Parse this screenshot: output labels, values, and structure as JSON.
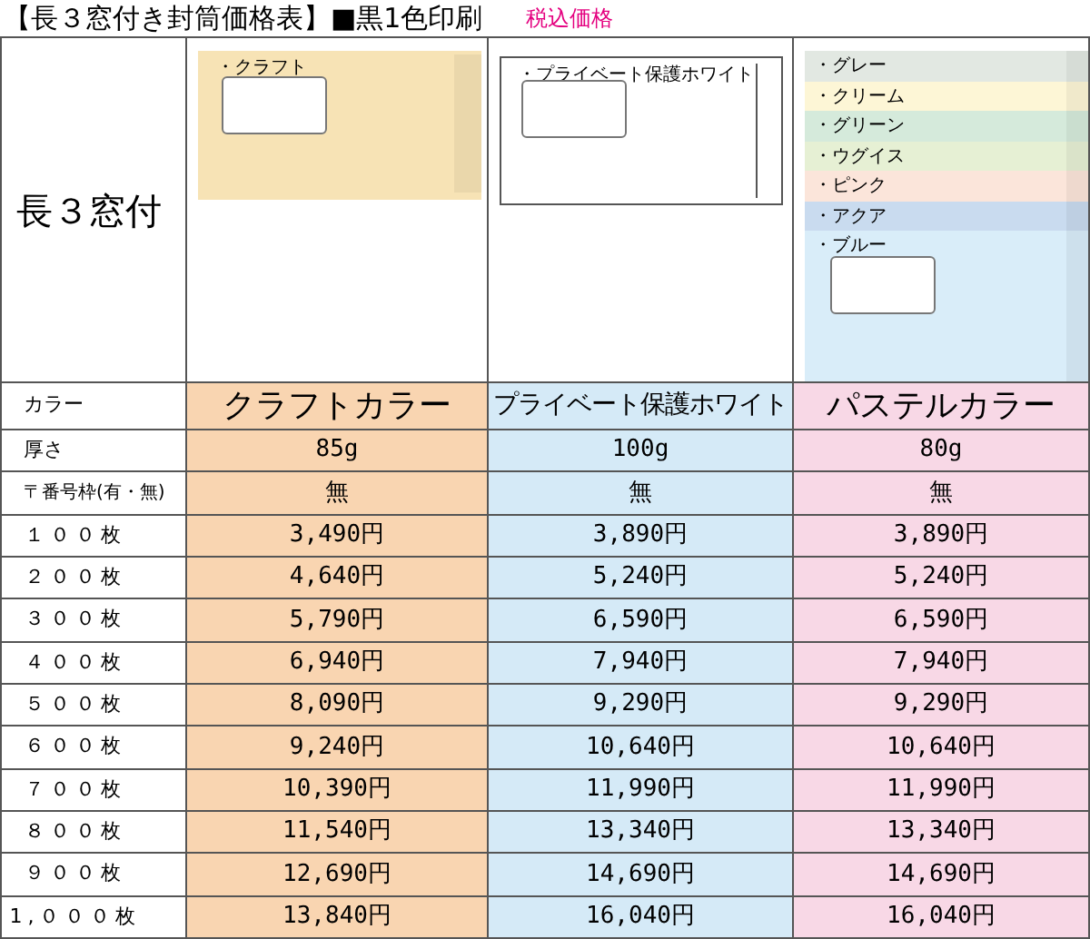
{
  "title": "【長３窓付き封筒価格表】■黒1色印刷",
  "tax_note": "税込価格",
  "row_header": "長３窓付",
  "envelopes": [
    {
      "kind": "filled",
      "color": "#f7e3b5",
      "label": "・クラフト"
    },
    {
      "kind": "outline",
      "label": "・プライベート保護ホワイト"
    },
    {
      "kind": "stacked",
      "bands": [
        {
          "label": "・グレー",
          "color": "#e2e8e2"
        },
        {
          "label": "・クリーム",
          "color": "#fdf6d6"
        },
        {
          "label": "・グリーン",
          "color": "#d5eadb"
        },
        {
          "label": "・ウグイス",
          "color": "#e6f0d4"
        },
        {
          "label": "・ピンク",
          "color": "#fbe5da"
        },
        {
          "label": "・アクア",
          "color": "#c9dbef"
        },
        {
          "label": "・ブルー",
          "color": "#d9edf9"
        }
      ]
    }
  ],
  "header_label": "カラー",
  "columns": [
    {
      "name": "クラフトカラー",
      "color": "#f9d5b1"
    },
    {
      "name": "プライベート保護ホワイト",
      "color": "#d5eaf7"
    },
    {
      "name": "パステルカラー",
      "color": "#f8d8e6"
    }
  ],
  "rows": [
    {
      "label": "厚さ",
      "values": [
        "85g",
        "100g",
        "80g"
      ]
    },
    {
      "label": "〒番号枠(有・無)",
      "values": [
        "無",
        "無",
        "無"
      ]
    },
    {
      "label": "１００枚",
      "values": [
        "3,490円",
        "3,890円",
        "3,890円"
      ]
    },
    {
      "label": "２００枚",
      "values": [
        "4,640円",
        "5,240円",
        "5,240円"
      ]
    },
    {
      "label": "３００枚",
      "values": [
        "5,790円",
        "6,590円",
        "6,590円"
      ]
    },
    {
      "label": "４００枚",
      "values": [
        "6,940円",
        "7,940円",
        "7,940円"
      ]
    },
    {
      "label": "５００枚",
      "values": [
        "8,090円",
        "9,290円",
        "9,290円"
      ]
    },
    {
      "label": "６００枚",
      "values": [
        "9,240円",
        "10,640円",
        "10,640円"
      ]
    },
    {
      "label": "７００枚",
      "values": [
        "10,390円",
        "11,990円",
        "11,990円"
      ]
    },
    {
      "label": "８００枚",
      "values": [
        "11,540円",
        "13,340円",
        "13,340円"
      ]
    },
    {
      "label": "９００枚",
      "values": [
        "12,690円",
        "14,690円",
        "14,690円"
      ]
    },
    {
      "label": "1,０００枚",
      "values": [
        "13,840円",
        "16,040円",
        "16,040円"
      ]
    }
  ]
}
